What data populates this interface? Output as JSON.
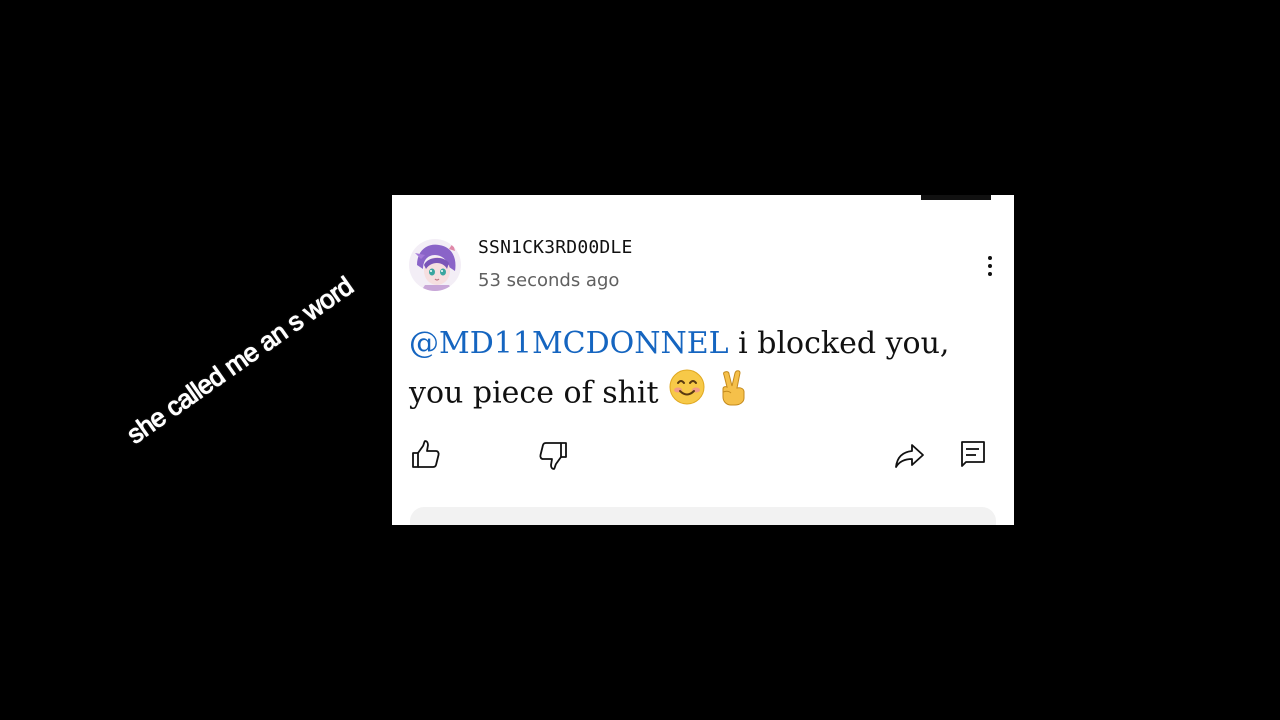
{
  "overlay": {
    "caption": "she called me an s word"
  },
  "comment": {
    "author": "SSN1CK3RD00DLE",
    "timestamp": "53 seconds ago",
    "mention": "@MD11MCDONNEL",
    "text_line1": " i blocked you,",
    "text_line2": "you piece of shit "
  },
  "icons": {
    "avatar": "anime-avatar",
    "more": "vertical-dots-icon",
    "like": "thumbs-up-icon",
    "dislike": "thumbs-down-icon",
    "share": "share-arrow-icon",
    "reply": "comment-reply-icon",
    "emoji_1": "smiling-face-emoji",
    "emoji_2": "victory-hand-emoji"
  },
  "colors": {
    "background": "#000000",
    "card": "#ffffff",
    "mention": "#1565c0",
    "timestamp": "#606060"
  }
}
